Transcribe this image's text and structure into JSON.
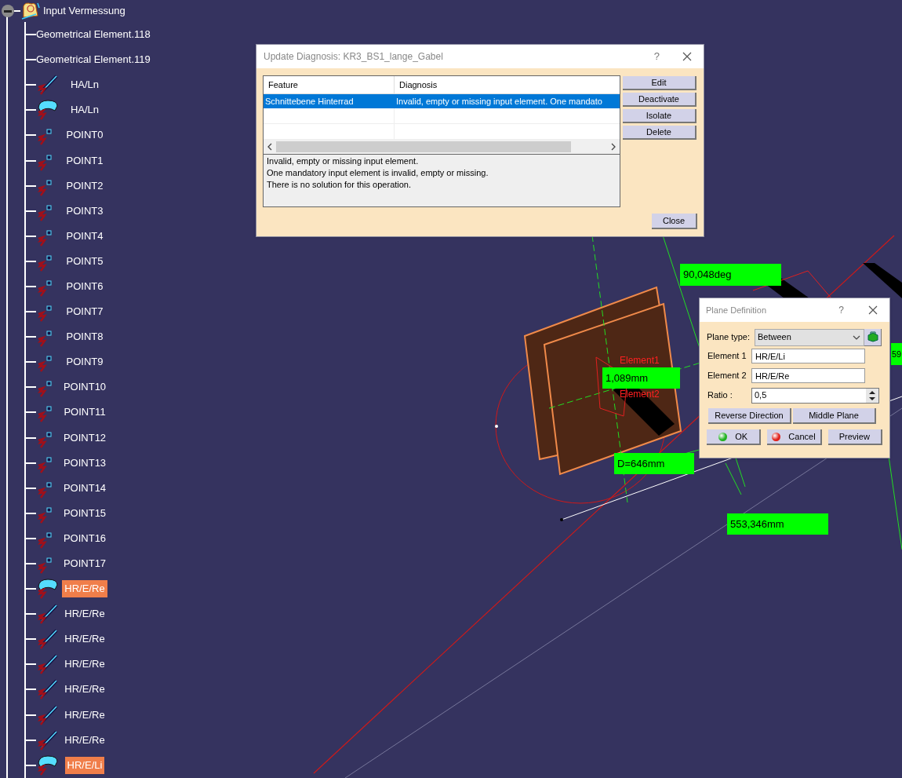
{
  "tree": {
    "label": "Input Vermessung",
    "expanded": true,
    "children": [
      {
        "label": "Geometrical Element.118",
        "kind": "plain",
        "selected": false
      },
      {
        "label": "Geometrical Element.119",
        "kind": "plain",
        "selected": false
      },
      {
        "label": "HA/Ln",
        "kind": "line",
        "selected": false
      },
      {
        "label": "HA/Ln",
        "kind": "surface",
        "selected": false
      },
      {
        "label": "POINT0",
        "kind": "point",
        "selected": false
      },
      {
        "label": "POINT1",
        "kind": "point",
        "selected": false
      },
      {
        "label": "POINT2",
        "kind": "point",
        "selected": false
      },
      {
        "label": "POINT3",
        "kind": "point",
        "selected": false
      },
      {
        "label": "POINT4",
        "kind": "point",
        "selected": false
      },
      {
        "label": "POINT5",
        "kind": "point",
        "selected": false
      },
      {
        "label": "POINT6",
        "kind": "point",
        "selected": false
      },
      {
        "label": "POINT7",
        "kind": "point",
        "selected": false
      },
      {
        "label": "POINT8",
        "kind": "point",
        "selected": false
      },
      {
        "label": "POINT9",
        "kind": "point",
        "selected": false
      },
      {
        "label": "POINT10",
        "kind": "point",
        "selected": false
      },
      {
        "label": "POINT11",
        "kind": "point",
        "selected": false
      },
      {
        "label": "POINT12",
        "kind": "point",
        "selected": false
      },
      {
        "label": "POINT13",
        "kind": "point",
        "selected": false
      },
      {
        "label": "POINT14",
        "kind": "point",
        "selected": false
      },
      {
        "label": "POINT15",
        "kind": "point",
        "selected": false
      },
      {
        "label": "POINT16",
        "kind": "point",
        "selected": false
      },
      {
        "label": "POINT17",
        "kind": "point",
        "selected": false
      },
      {
        "label": "HR/E/Re",
        "kind": "surface",
        "selected": true
      },
      {
        "label": "HR/E/Re",
        "kind": "line",
        "selected": false
      },
      {
        "label": "HR/E/Re",
        "kind": "line",
        "selected": false
      },
      {
        "label": "HR/E/Re",
        "kind": "line",
        "selected": false
      },
      {
        "label": "HR/E/Re",
        "kind": "line",
        "selected": false
      },
      {
        "label": "HR/E/Re",
        "kind": "line",
        "selected": false
      },
      {
        "label": "HR/E/Re",
        "kind": "line",
        "selected": false
      },
      {
        "label": "HR/E/Li",
        "kind": "surface",
        "selected": true
      }
    ]
  },
  "viewport": {
    "labels": [
      {
        "text": "90,048deg",
        "kind": "dimension"
      },
      {
        "text": "1,089mm",
        "kind": "dimension"
      },
      {
        "text": "D=646mm",
        "kind": "dimension"
      },
      {
        "text": "553,346mm",
        "kind": "dimension"
      },
      {
        "text": "59",
        "kind": "dimension"
      },
      {
        "text": "Element1",
        "kind": "tag"
      },
      {
        "text": "Element2",
        "kind": "tag"
      }
    ]
  },
  "update_diagnosis": {
    "title": "Update Diagnosis: KR3_BS1_lange_Gabel",
    "help": "?",
    "columns": [
      "Feature",
      "Diagnosis"
    ],
    "rows": [
      {
        "cells": [
          "Schnittebene Hinterrad",
          "Invalid, empty or missing input element. One mandato"
        ],
        "selected": true
      }
    ],
    "message": [
      "Invalid, empty or missing input element.",
      "One mandatory input element is invalid, empty or missing.",
      "There is no solution for this operation."
    ],
    "buttons": [
      "Edit",
      "Deactivate",
      "Isolate",
      "Delete"
    ],
    "close_button": "Close"
  },
  "plane_definition": {
    "title": "Plane Definition",
    "help": "?",
    "plane_type": {
      "label": "Plane type:",
      "value": "Between"
    },
    "element_1": {
      "label": "Element 1",
      "value": "HR/E/Li"
    },
    "element_2": {
      "label": "Element 2",
      "value": "HR/E/Re"
    },
    "ratio": {
      "label": "Ratio :",
      "value": "0,5"
    },
    "option_buttons": [
      "Reverse Direction",
      "Middle Plane"
    ],
    "buttons": [
      {
        "label": "OK",
        "kind": "ok"
      },
      {
        "label": "Cancel",
        "kind": "cancel"
      },
      {
        "label": "Preview",
        "kind": "plain"
      }
    ]
  }
}
